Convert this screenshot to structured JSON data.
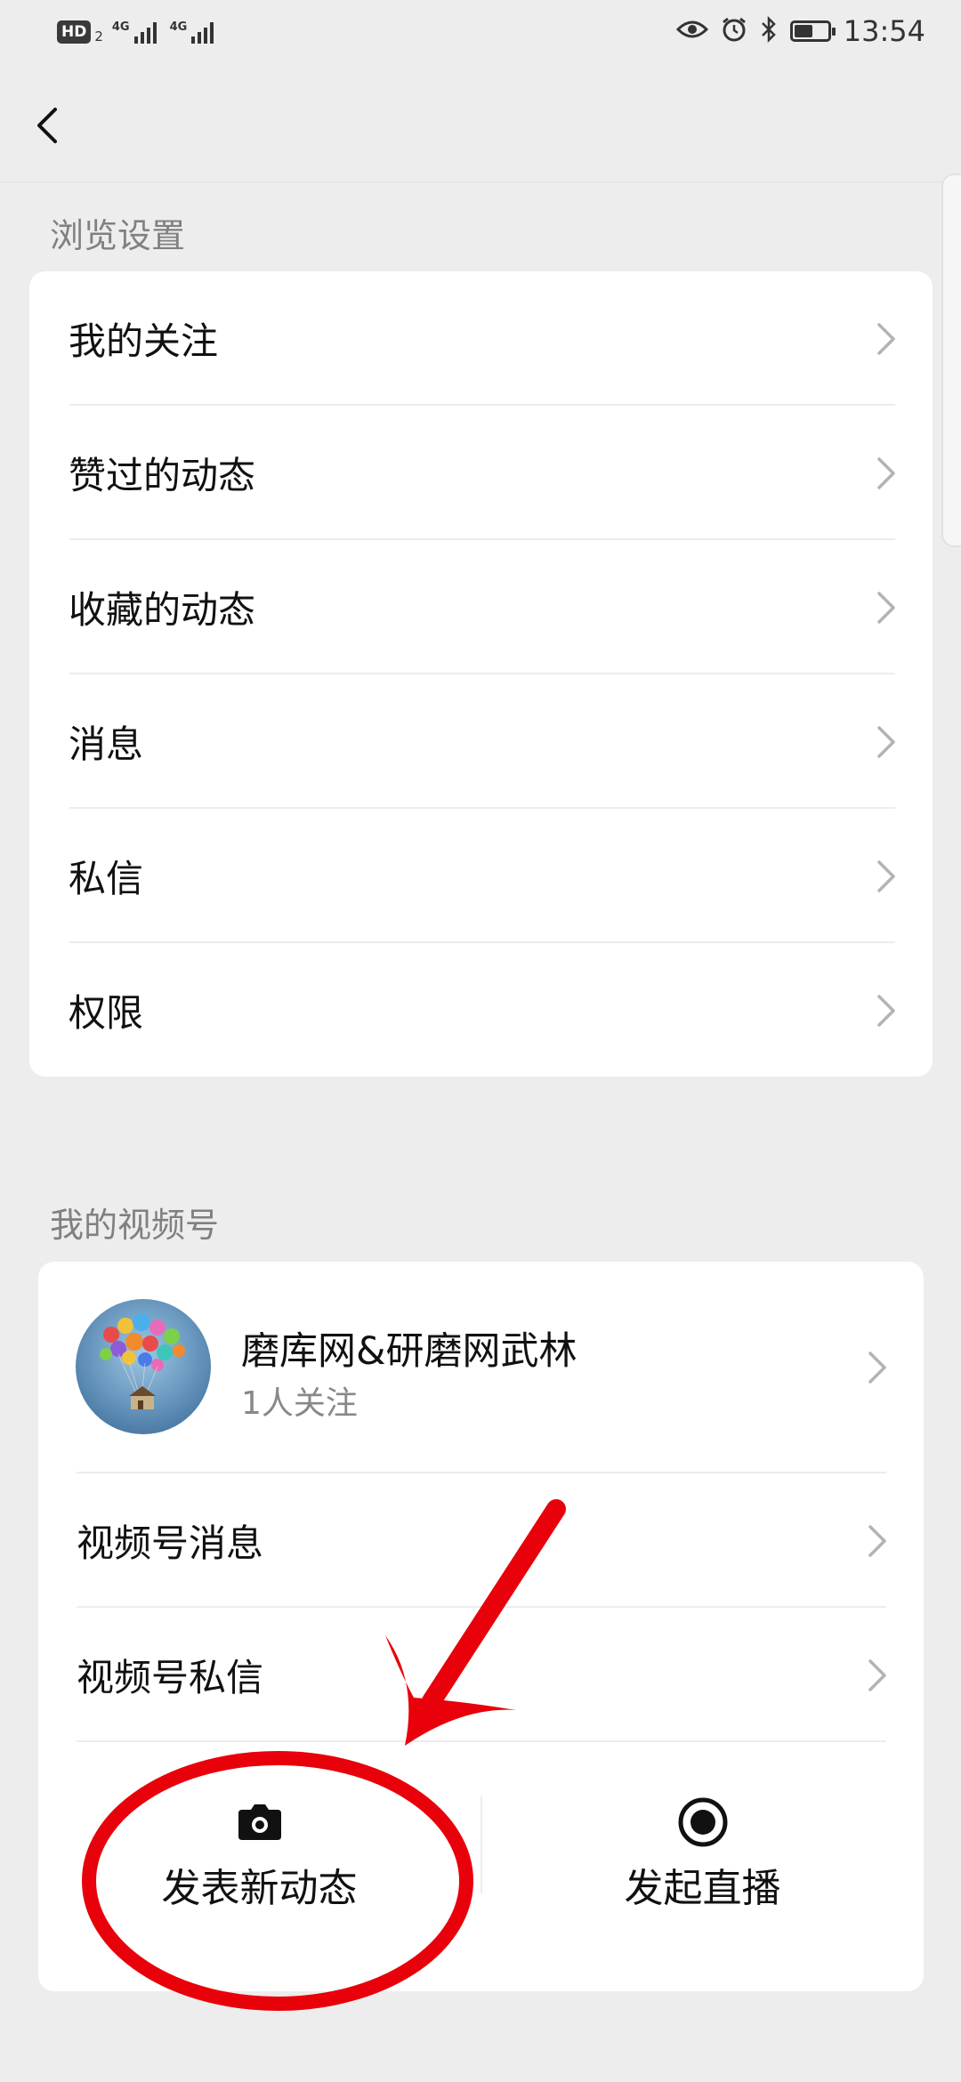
{
  "status_bar": {
    "hd_label": "HD",
    "hd_sub": "2",
    "net1": "4G",
    "net2": "4G",
    "time": "13:54",
    "battery_level": 0.55
  },
  "browse": {
    "title": "浏览设置",
    "items": [
      {
        "label": "我的关注"
      },
      {
        "label": "赞过的动态"
      },
      {
        "label": "收藏的动态"
      },
      {
        "label": "消息"
      },
      {
        "label": "私信"
      },
      {
        "label": "权限"
      }
    ]
  },
  "channel": {
    "title": "我的视频号",
    "profile": {
      "name": "磨库网&研磨网武林",
      "followers": "1人关注"
    },
    "items": [
      {
        "label": "视频号消息"
      },
      {
        "label": "视频号私信"
      }
    ],
    "actions": {
      "post_label": "发表新动态",
      "live_label": "发起直播"
    }
  },
  "colors": {
    "background": "#ededed",
    "card": "#ffffff",
    "annotation_red": "#e8000a",
    "secondary_text": "#808080"
  }
}
